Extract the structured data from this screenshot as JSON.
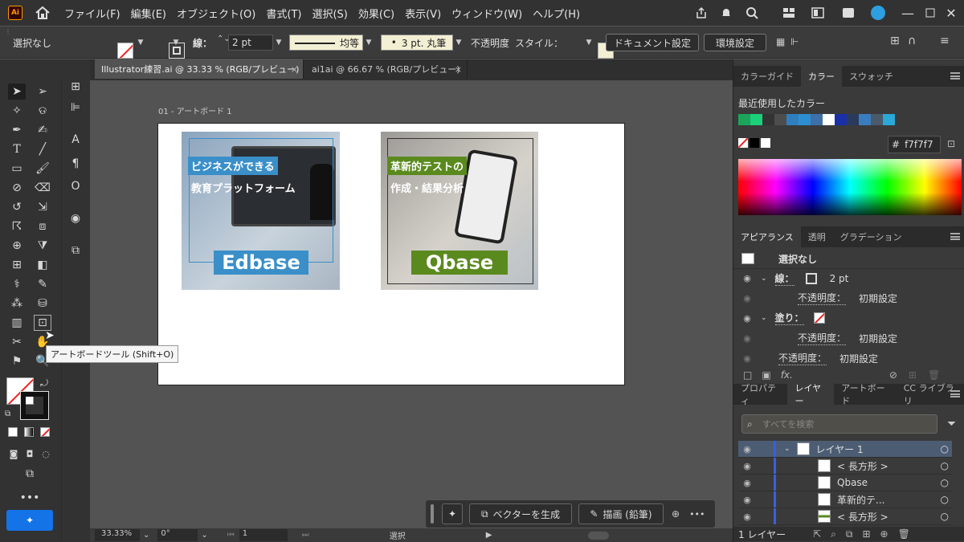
{
  "app": {
    "logo": "Ai"
  },
  "menu": [
    "ファイル(F)",
    "編集(E)",
    "オブジェクト(O)",
    "書式(T)",
    "選択(S)",
    "効果(C)",
    "表示(V)",
    "ウィンドウ(W)",
    "ヘルプ(H)"
  ],
  "control": {
    "selection": "選択なし",
    "stroke_label": "線：",
    "stroke_weight": "2 pt",
    "stroke_profile": "均等",
    "brush": "3 pt. 丸筆",
    "opacity_label": "不透明度",
    "style_label": "スタイル：",
    "doc_settings": "ドキュメント設定",
    "prefs": "環境設定"
  },
  "tabs": [
    {
      "label": "Illustrator練習.ai @ 33.33 % (RGB/プレビュー)",
      "close": "×"
    },
    {
      "label": "ai1ai @ 66.67 % (RGB/プレビュー)",
      "close": "×"
    }
  ],
  "artboard": {
    "label": "01 - アートボード 1"
  },
  "cards": [
    {
      "line1": "ビジネスができる",
      "line2": "教育プラットフォーム",
      "brand": "Edbase"
    },
    {
      "line1": "革新的テストの",
      "line2": "作成・結果分析",
      "brand": "Qbase"
    }
  ],
  "tooltip": "アートボードツール (Shift+O)",
  "floatbar": {
    "vector": "ベクターを生成",
    "draw": "描画 (鉛筆)",
    "more": "•••"
  },
  "status": {
    "zoom": "33.33%",
    "rotation": "0°",
    "artboard_num": "1",
    "mode": "選択"
  },
  "color_panel": {
    "tabs": [
      "カラーガイド",
      "カラー",
      "スウォッチ"
    ],
    "recent_label": "最近使用したカラー",
    "recent": [
      "#1aa55a",
      "#1bd07a",
      "#333333",
      "#4d4d4d",
      "#2f7fbf",
      "#2d8fd0",
      "#3d6fa8",
      "#ffffff",
      "#1a2fa8",
      "#2a3a5a",
      "#3a7dbf",
      "#4a5a6a",
      "#2aa8d8"
    ],
    "hex_label": "#",
    "hex": "f7f7f7"
  },
  "appearance": {
    "tabs": [
      "アピアランス",
      "透明",
      "グラデーション"
    ],
    "title": "選択なし",
    "stroke": "線：",
    "stroke_weight": "2 pt",
    "opacity": "不透明度：",
    "default": "初期設定",
    "fill": "塗り：",
    "opacity2": "不透明度：",
    "fx": "fx."
  },
  "layers": {
    "tabs": [
      "プロパティ",
      "レイヤー",
      "アートボード",
      "CC ライブラリ"
    ],
    "search_placeholder": "すべてを検索",
    "rows": [
      "レイヤー 1",
      "< 長方形 >",
      "Qbase",
      "革新的テ...",
      "< 長方形 >"
    ],
    "footer": "1 レイヤー"
  }
}
